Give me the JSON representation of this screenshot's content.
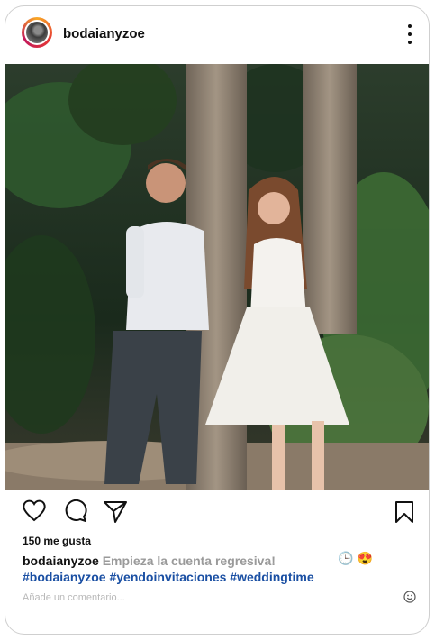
{
  "header": {
    "username": "bodaianyzoe",
    "avatar_icon": "profile-photo-avatar",
    "more_icon": "more-vertical-icon"
  },
  "post": {
    "image_description_icon": "couple-in-forest-photo",
    "colors": {
      "tree": "#8d7e6f",
      "forest": "#1f3322",
      "shirt": "#e8eaee",
      "dress": "#f4f2ee"
    }
  },
  "actions": {
    "like_icon": "heart-icon",
    "comment_icon": "comment-bubble-icon",
    "share_icon": "send-paper-plane-icon",
    "save_icon": "bookmark-icon"
  },
  "likes": "150 me gusta",
  "caption": {
    "user": "bodaianyzoe",
    "text": "Empieza la cuenta regresiva!",
    "hashtags": "#bodaianyzoe #yendoinvitaciones #weddingtime",
    "emoji_1": "🕒",
    "emoji_2": "😍"
  },
  "comment": {
    "placeholder": "Añade un comentario...",
    "emoji_icon": "smiley-icon"
  },
  "accent": "#1a4fa3"
}
